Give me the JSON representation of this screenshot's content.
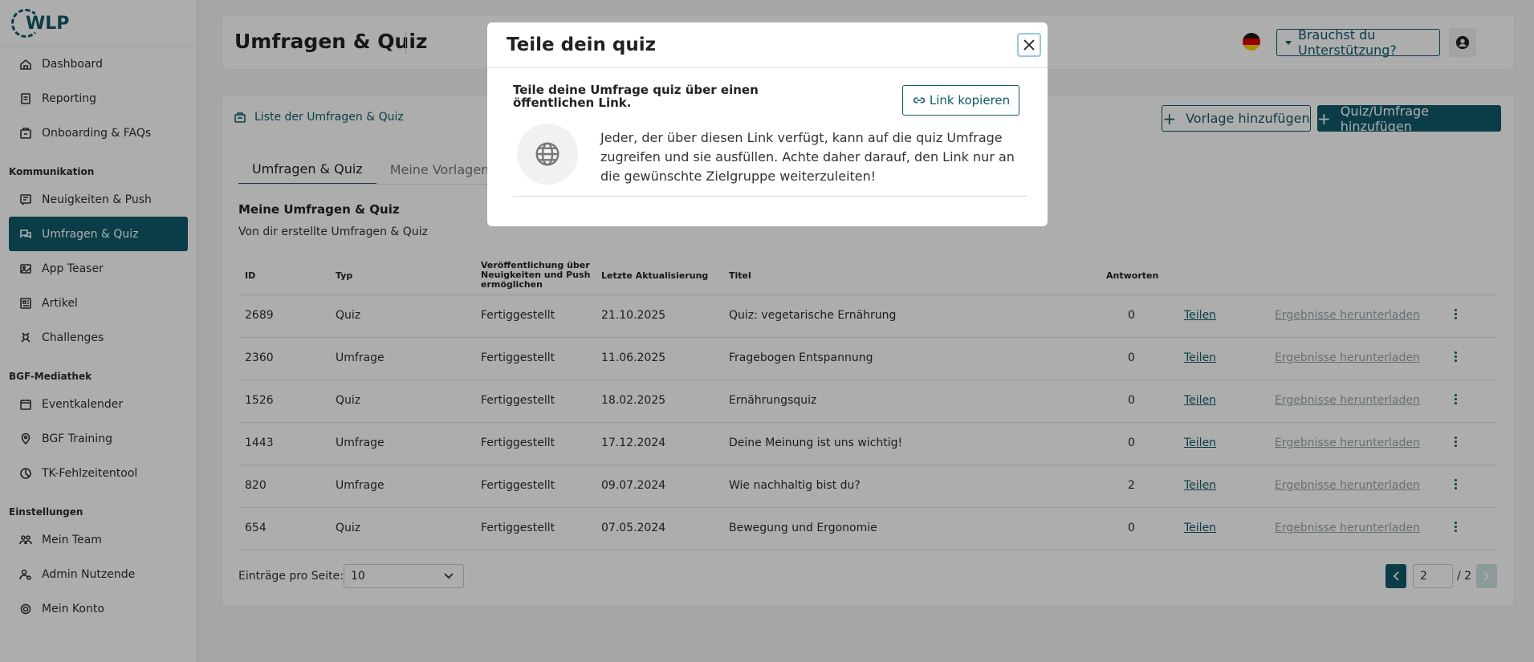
{
  "app": {
    "logo_text": "WLP"
  },
  "sidebar": {
    "items_top": [
      {
        "label": "Dashboard",
        "icon": "home-icon"
      },
      {
        "label": "Reporting",
        "icon": "document-icon"
      },
      {
        "label": "Onboarding & FAQs",
        "icon": "onboarding-icon"
      }
    ],
    "section_kommunikation": "Kommunikation",
    "items_kommunikation": [
      {
        "label": "Neuigkeiten & Push",
        "icon": "news-icon"
      },
      {
        "label": "Umfragen & Quiz",
        "icon": "chat-icon",
        "active": true
      },
      {
        "label": "App Teaser",
        "icon": "image-icon"
      },
      {
        "label": "Artikel",
        "icon": "article-icon"
      },
      {
        "label": "Challenges",
        "icon": "challenge-icon"
      }
    ],
    "section_mediathek": "BGF-Mediathek",
    "items_mediathek": [
      {
        "label": "Eventkalender",
        "icon": "calendar-icon"
      },
      {
        "label": "BGF Training",
        "icon": "location-pin-icon"
      },
      {
        "label": "TK-Fehlzeitentool",
        "icon": "chart-icon"
      }
    ],
    "section_einstellungen": "Einstellungen",
    "items_einstellungen": [
      {
        "label": "Mein Team",
        "icon": "team-icon"
      },
      {
        "label": "Admin Nutzende",
        "icon": "admin-icon"
      },
      {
        "label": "Mein Konto",
        "icon": "gear-icon"
      }
    ]
  },
  "header": {
    "title": "Umfragen & Quiz",
    "support_label": "Brauchst du Unterstützung?",
    "colors": {
      "primary": "#0f5b6b"
    }
  },
  "main": {
    "breadcrumb": "Liste der Umfragen & Quiz",
    "add_template_label": "Vorlage hinzufügen",
    "add_quiz_label": "Quiz/Umfrage hinzufügen",
    "tabs": [
      {
        "label": "Umfragen & Quiz"
      },
      {
        "label": "Meine Vorlagen"
      }
    ],
    "section_title": "Meine Umfragen & Quiz",
    "section_subtitle": "Von dir erstellte Umfragen & Quiz",
    "columns": {
      "id": "ID",
      "type": "Typ",
      "publish": "Veröffentlichung über Neuigkeiten und Push ermöglichen",
      "updated": "Letzte Aktualisierung",
      "title": "Titel",
      "answers": "Antworten"
    },
    "share_label": "Teilen",
    "download_label": "Ergebnisse herunterladen",
    "rows": [
      {
        "id": "2689",
        "type": "Quiz",
        "publish": "Fertiggestellt",
        "updated": "21.10.2025",
        "title": "Quiz: vegetarische Ernährung",
        "answers": "0"
      },
      {
        "id": "2360",
        "type": "Umfrage",
        "publish": "Fertiggestellt",
        "updated": "11.06.2025",
        "title": "Fragebogen Entspannung",
        "answers": "0"
      },
      {
        "id": "1526",
        "type": "Quiz",
        "publish": "Fertiggestellt",
        "updated": "18.02.2025",
        "title": "Ernährungsquiz",
        "answers": "0"
      },
      {
        "id": "1443",
        "type": "Umfrage",
        "publish": "Fertiggestellt",
        "updated": "17.12.2024",
        "title": "Deine Meinung ist uns wichtig!",
        "answers": "0"
      },
      {
        "id": "820",
        "type": "Umfrage",
        "publish": "Fertiggestellt",
        "updated": "09.07.2024",
        "title": "Wie nachhaltig bist du?",
        "answers": "2"
      },
      {
        "id": "654",
        "type": "Quiz",
        "publish": "Fertiggestellt",
        "updated": "07.05.2024",
        "title": "Bewegung und Ergonomie",
        "answers": "0"
      }
    ],
    "pagination": {
      "per_page_label": "Einträge pro Seite:",
      "per_page_value": "10",
      "current_page": "2",
      "total_pages": "/ 2"
    }
  },
  "modal": {
    "title": "Teile dein quiz",
    "subtitle": "Teile deine Umfrage quiz über einen öffentlichen Link.",
    "copy_label": "Link kopieren",
    "description": "Jeder, der über diesen Link verfügt, kann auf die quiz Umfrage zugreifen und sie ausfüllen. Achte daher darauf, den Link nur an die gewünschte Zielgruppe weiterzuleiten!"
  }
}
